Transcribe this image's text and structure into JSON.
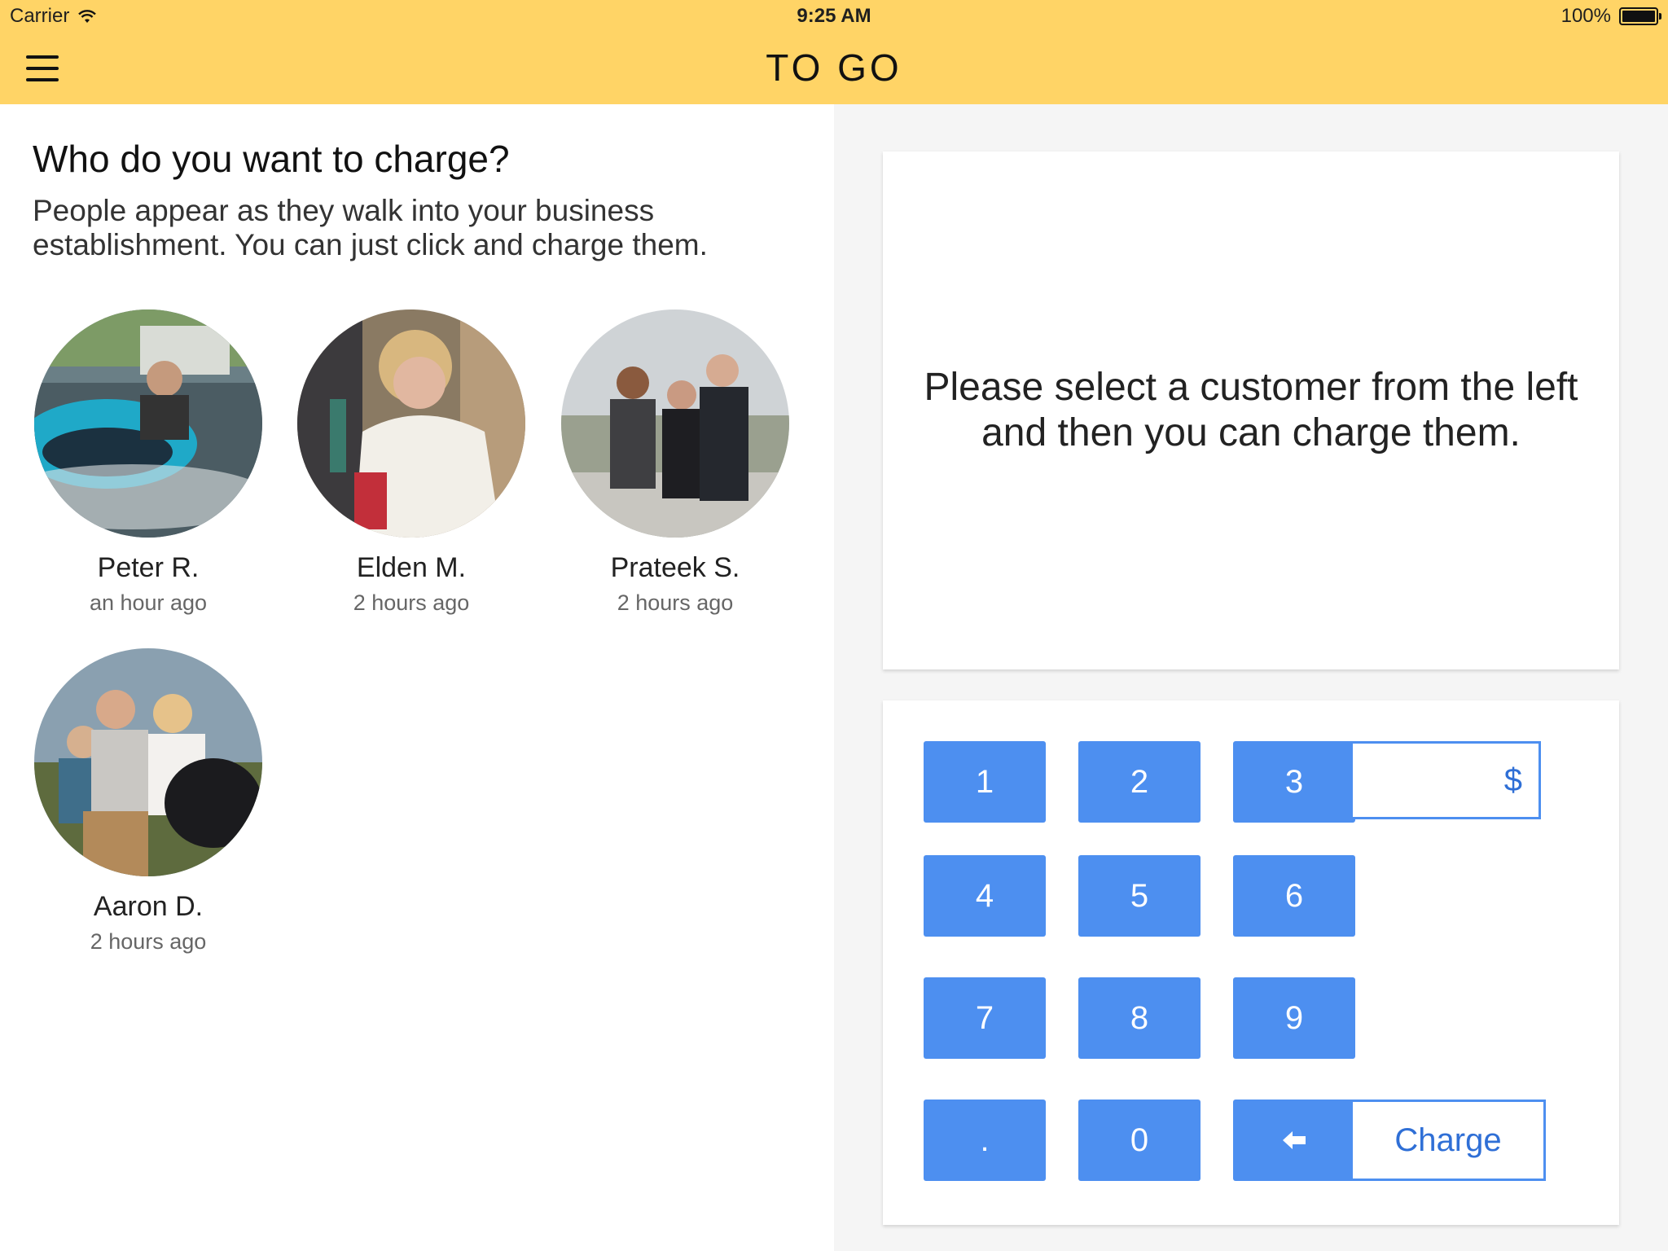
{
  "status_bar": {
    "carrier": "Carrier",
    "time": "9:25 AM",
    "battery": "100%"
  },
  "header": {
    "title": "TO GO"
  },
  "left": {
    "title": "Who do you want to charge?",
    "subtitle": "People appear as they walk into your business establishment. You can just click and charge them.",
    "customers": [
      {
        "name": "Peter R.",
        "time": "an hour ago"
      },
      {
        "name": "Elden M.",
        "time": "2 hours ago"
      },
      {
        "name": "Prateek S.",
        "time": "2 hours ago"
      },
      {
        "name": "Aaron D.",
        "time": "2 hours ago"
      }
    ]
  },
  "right": {
    "info": "Please select a customer from the left and then you can charge them.",
    "keypad": {
      "keys": [
        "1",
        "2",
        "3",
        "4",
        "5",
        "6",
        "7",
        "8",
        "9",
        ".",
        "0"
      ],
      "amount_value": "",
      "currency_symbol": "$",
      "charge_label": "Charge"
    }
  },
  "colors": {
    "header": "#ffd466",
    "accent": "#4d8ff0"
  }
}
